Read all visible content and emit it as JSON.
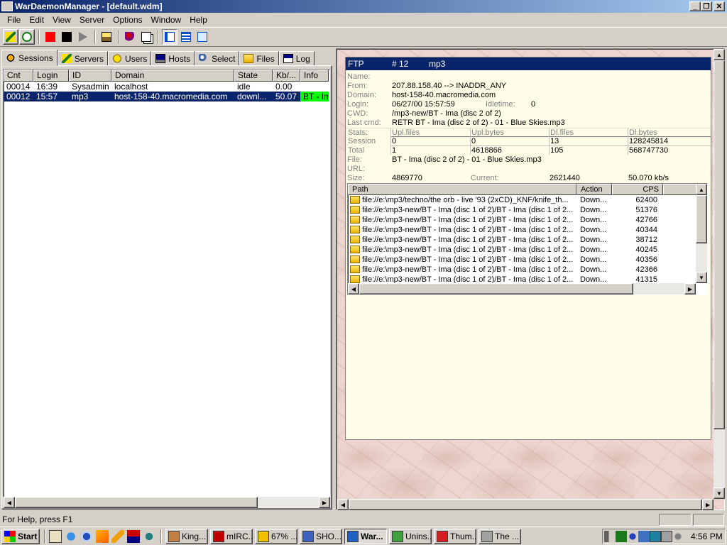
{
  "window": {
    "title": "WarDaemonManager - [default.wdm]",
    "min": "_",
    "restore": "❐",
    "close": "✕"
  },
  "menu": [
    "File",
    "Edit",
    "View",
    "Server",
    "Options",
    "Window",
    "Help"
  ],
  "toolbar": {
    "buttons": [
      "connect-icon",
      "refresh-icon",
      "record-icon",
      "stop-icon",
      "play-icon",
      "server-icon",
      "users-icon",
      "copy-icon",
      "view-list-icon",
      "view-detail-icon",
      "view-icons-icon"
    ]
  },
  "tabs": [
    {
      "label": "Sessions",
      "icon": "sessions-icon",
      "active": true
    },
    {
      "label": "Servers",
      "icon": "servers-icon"
    },
    {
      "label": "Users",
      "icon": "users-icon"
    },
    {
      "label": "Hosts",
      "icon": "hosts-icon"
    },
    {
      "label": "Select",
      "icon": "select-icon"
    },
    {
      "label": "Files",
      "icon": "files-icon"
    },
    {
      "label": "Log",
      "icon": "log-icon"
    }
  ],
  "sessions": {
    "columns": [
      "Cnt",
      "Login",
      "ID",
      "Domain",
      "State",
      "Kb/...",
      "Info"
    ],
    "rows": [
      {
        "cnt": "00014",
        "login": "16:39",
        "id": "Sysadmin",
        "domain": "localhost",
        "state": "idle",
        "kb": "0.00",
        "info": "",
        "selected": false
      },
      {
        "cnt": "00012",
        "login": "15:57",
        "id": "mp3",
        "domain": "host-158-40.macromedia.com",
        "state": "downl...",
        "kb": "50.07",
        "info": "BT - Ima",
        "selected": true
      }
    ]
  },
  "detail": {
    "header": {
      "proto": "FTP",
      "num": "# 12",
      "user": "mp3"
    },
    "labels": {
      "name": "Name:",
      "from": "From:",
      "domain": "Domain:",
      "login": "Login:",
      "cwd": "CWD:",
      "lastcmd": "Last cmd:",
      "idletime": "Idletime:",
      "file": "File:",
      "url": "URL:",
      "size": "Size:",
      "current": "Current:"
    },
    "name": "",
    "from": "207.88.158.40 --> INADDR_ANY",
    "domain": "host-158-40.macromedia.com",
    "login": "06/27/00 15:57:59",
    "idletime": "0",
    "cwd": "/mp3-new/BT - Ima (disc 2 of 2)",
    "lastcmd": "RETR BT - Ima (disc 2 of 2) - 01 - Blue Skies.mp3",
    "stats": {
      "headers": [
        "Stats:",
        "Upl.files",
        "Upl.bytes",
        "Dl.files",
        "Dl.bytes"
      ],
      "session": [
        "Session",
        "0",
        "0",
        "13",
        "128245814"
      ],
      "total": [
        "Total",
        "1",
        "4618866",
        "105",
        "568747730"
      ]
    },
    "file": "BT - Ima (disc 2 of 2) - 01 - Blue Skies.mp3",
    "url": "",
    "size": "4869770",
    "current": "2621440",
    "rate": "50.070 kb/s"
  },
  "transfers": {
    "columns": [
      "Path",
      "Action",
      "CPS"
    ],
    "rows": [
      {
        "path": "file://e:\\mp3/techno/the orb - live '93 (2xCD)_KNF/knife_th...",
        "action": "Down...",
        "cps": "62400"
      },
      {
        "path": "file://e:\\mp3-new/BT - Ima (disc 1 of 2)/BT - Ima (disc 1 of 2...",
        "action": "Down...",
        "cps": "51376"
      },
      {
        "path": "file://e:\\mp3-new/BT - Ima (disc 1 of 2)/BT - Ima (disc 1 of 2...",
        "action": "Down...",
        "cps": "42766"
      },
      {
        "path": "file://e:\\mp3-new/BT - Ima (disc 1 of 2)/BT - Ima (disc 1 of 2...",
        "action": "Down...",
        "cps": "40344"
      },
      {
        "path": "file://e:\\mp3-new/BT - Ima (disc 1 of 2)/BT - Ima (disc 1 of 2...",
        "action": "Down...",
        "cps": "38712"
      },
      {
        "path": "file://e:\\mp3-new/BT - Ima (disc 1 of 2)/BT - Ima (disc 1 of 2...",
        "action": "Down...",
        "cps": "40245"
      },
      {
        "path": "file://e:\\mp3-new/BT - Ima (disc 1 of 2)/BT - Ima (disc 1 of 2...",
        "action": "Down...",
        "cps": "40356"
      },
      {
        "path": "file://e:\\mp3-new/BT - Ima (disc 1 of 2)/BT - Ima (disc 1 of 2...",
        "action": "Down...",
        "cps": "42366"
      },
      {
        "path": "file://e:\\mp3-new/BT - Ima (disc 1 of 2)/BT - Ima (disc 1 of 2...",
        "action": "Down...",
        "cps": "41315"
      }
    ]
  },
  "status": {
    "text": "For Help, press F1"
  },
  "taskbar": {
    "start": "Start",
    "tasks": [
      {
        "label": "King...",
        "icon": "king-icon",
        "active": false
      },
      {
        "label": "mIRC...",
        "icon": "mirc-icon",
        "active": false
      },
      {
        "label": "67% ...",
        "icon": "download-icon",
        "active": false
      },
      {
        "label": "SHO...",
        "icon": "search-icon",
        "active": false
      },
      {
        "label": "War...",
        "icon": "wardaemon-icon",
        "active": true
      },
      {
        "label": "Unins...",
        "icon": "uninstall-icon",
        "active": false
      },
      {
        "label": "Thum...",
        "icon": "thumbs-icon",
        "active": false
      },
      {
        "label": "The ...",
        "icon": "app-icon",
        "active": false
      }
    ],
    "clock": "4:56 PM"
  },
  "colors": {
    "selection": "#0a246a",
    "info_highlight": "#00ff00",
    "detail_bg": "#fefee8",
    "record": "#ff0000"
  }
}
